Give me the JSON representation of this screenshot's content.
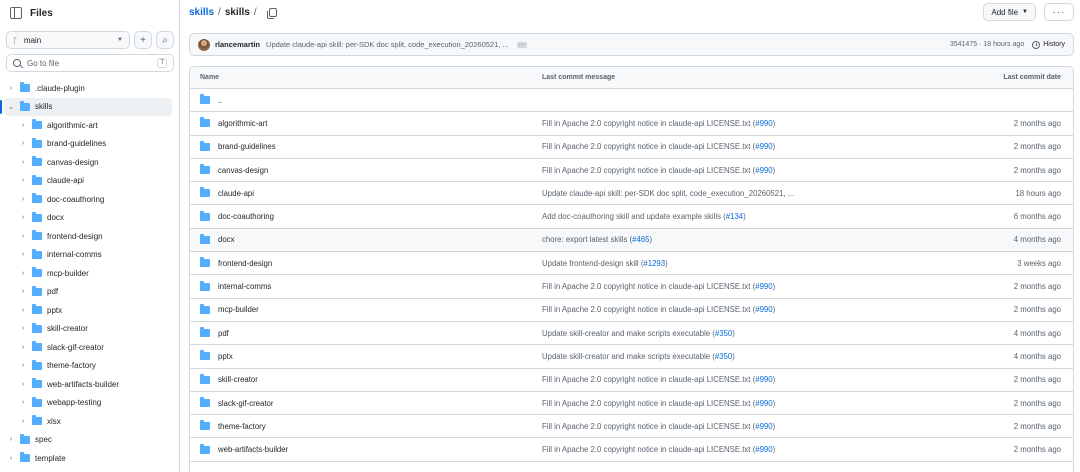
{
  "sidebar": {
    "title": "Files",
    "branch": "main",
    "search_placeholder": "Go to file",
    "search_shortcut": "T",
    "tree": [
      {
        "label": ".claude-plugin",
        "level": 0,
        "expanded": false,
        "selected": false
      },
      {
        "label": "skills",
        "level": 0,
        "expanded": true,
        "selected": true
      },
      {
        "label": "algorithmic-art",
        "level": 1,
        "expanded": false,
        "selected": false
      },
      {
        "label": "brand-guidelines",
        "level": 1,
        "expanded": false,
        "selected": false
      },
      {
        "label": "canvas-design",
        "level": 1,
        "expanded": false,
        "selected": false
      },
      {
        "label": "claude-api",
        "level": 1,
        "expanded": false,
        "selected": false
      },
      {
        "label": "doc-coauthoring",
        "level": 1,
        "expanded": false,
        "selected": false
      },
      {
        "label": "docx",
        "level": 1,
        "expanded": false,
        "selected": false
      },
      {
        "label": "frontend-design",
        "level": 1,
        "expanded": false,
        "selected": false
      },
      {
        "label": "internal-comms",
        "level": 1,
        "expanded": false,
        "selected": false
      },
      {
        "label": "mcp-builder",
        "level": 1,
        "expanded": false,
        "selected": false
      },
      {
        "label": "pdf",
        "level": 1,
        "expanded": false,
        "selected": false
      },
      {
        "label": "pptx",
        "level": 1,
        "expanded": false,
        "selected": false
      },
      {
        "label": "skill-creator",
        "level": 1,
        "expanded": false,
        "selected": false
      },
      {
        "label": "slack-gif-creator",
        "level": 1,
        "expanded": false,
        "selected": false
      },
      {
        "label": "theme-factory",
        "level": 1,
        "expanded": false,
        "selected": false
      },
      {
        "label": "web-artifacts-builder",
        "level": 1,
        "expanded": false,
        "selected": false
      },
      {
        "label": "webapp-testing",
        "level": 1,
        "expanded": false,
        "selected": false
      },
      {
        "label": "xlsx",
        "level": 1,
        "expanded": false,
        "selected": false
      },
      {
        "label": "spec",
        "level": 0,
        "expanded": false,
        "selected": false
      },
      {
        "label": "template",
        "level": 0,
        "expanded": false,
        "selected": false
      }
    ]
  },
  "breadcrumb": {
    "repo": "skills",
    "folder": "skills",
    "sep": "/"
  },
  "toolbar": {
    "add_file": "Add file",
    "more": "···"
  },
  "commit": {
    "author": "rlancemartin",
    "message": "Update claude-api skill: per-SDK doc split, code_execution_20260521, ...",
    "ellipsis": "···",
    "sha": "3541475",
    "age": "18 hours ago",
    "history": "History"
  },
  "table": {
    "headers": {
      "name": "Name",
      "message": "Last commit message",
      "date": "Last commit date"
    },
    "parent": "..",
    "rows": [
      {
        "name": "algorithmic-art",
        "msg": "Fill in Apache 2.0 copyright notice in claude-api LICENSE.txt (",
        "pr": "#990",
        "tail": ")",
        "date": "2 months ago",
        "hl": false
      },
      {
        "name": "brand-guidelines",
        "msg": "Fill in Apache 2.0 copyright notice in claude-api LICENSE.txt (",
        "pr": "#990",
        "tail": ")",
        "date": "2 months ago",
        "hl": false
      },
      {
        "name": "canvas-design",
        "msg": "Fill in Apache 2.0 copyright notice in claude-api LICENSE.txt (",
        "pr": "#990",
        "tail": ")",
        "date": "2 months ago",
        "hl": false
      },
      {
        "name": "claude-api",
        "msg": "Update claude-api skill: per-SDK doc split, code_execution_20260521, ...",
        "pr": "",
        "tail": "",
        "date": "18 hours ago",
        "hl": false
      },
      {
        "name": "doc-coauthoring",
        "msg": "Add doc-coauthoring skill and update example skills (",
        "pr": "#134",
        "tail": ")",
        "date": "6 months ago",
        "hl": false
      },
      {
        "name": "docx",
        "msg": "chore: export latest skills (",
        "pr": "#465",
        "tail": ")",
        "date": "4 months ago",
        "hl": true
      },
      {
        "name": "frontend-design",
        "msg": "Update frontend-design skill (",
        "pr": "#1293",
        "tail": ")",
        "date": "3 weeks ago",
        "hl": false
      },
      {
        "name": "internal-comms",
        "msg": "Fill in Apache 2.0 copyright notice in claude-api LICENSE.txt (",
        "pr": "#990",
        "tail": ")",
        "date": "2 months ago",
        "hl": false
      },
      {
        "name": "mcp-builder",
        "msg": "Fill in Apache 2.0 copyright notice in claude-api LICENSE.txt (",
        "pr": "#990",
        "tail": ")",
        "date": "2 months ago",
        "hl": false
      },
      {
        "name": "pdf",
        "msg": "Update skill-creator and make scripts executable (",
        "pr": "#350",
        "tail": ")",
        "date": "4 months ago",
        "hl": false
      },
      {
        "name": "pptx",
        "msg": "Update skill-creator and make scripts executable (",
        "pr": "#350",
        "tail": ")",
        "date": "4 months ago",
        "hl": false
      },
      {
        "name": "skill-creator",
        "msg": "Fill in Apache 2.0 copyright notice in claude-api LICENSE.txt (",
        "pr": "#990",
        "tail": ")",
        "date": "2 months ago",
        "hl": false
      },
      {
        "name": "slack-gif-creator",
        "msg": "Fill in Apache 2.0 copyright notice in claude-api LICENSE.txt (",
        "pr": "#990",
        "tail": ")",
        "date": "2 months ago",
        "hl": false
      },
      {
        "name": "theme-factory",
        "msg": "Fill in Apache 2.0 copyright notice in claude-api LICENSE.txt (",
        "pr": "#990",
        "tail": ")",
        "date": "2 months ago",
        "hl": false
      },
      {
        "name": "web-artifacts-builder",
        "msg": "Fill in Apache 2.0 copyright notice in claude-api LICENSE.txt (",
        "pr": "#990",
        "tail": ")",
        "date": "2 months ago",
        "hl": false
      }
    ]
  }
}
